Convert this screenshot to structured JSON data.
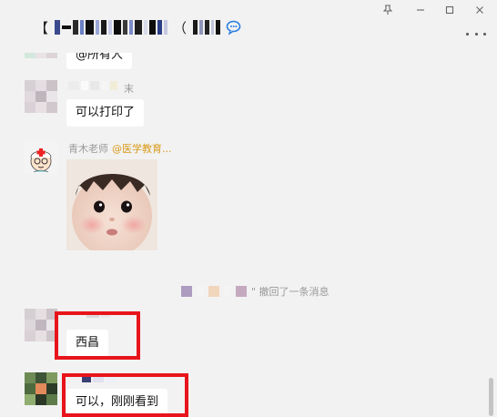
{
  "window": {
    "title": "【",
    "title_suffix": "（",
    "controls": {
      "pin": "📌",
      "minimize": "—",
      "maximize": "☐",
      "close": "✕"
    }
  },
  "messages": [
    {
      "id": "m0",
      "type": "text",
      "text": "@所有人"
    },
    {
      "id": "m1",
      "type": "text",
      "sender": "末",
      "text": "可以打印了"
    },
    {
      "id": "m2",
      "type": "image",
      "sender_name": "青木老师",
      "sender_tag": "@医学教育..."
    },
    {
      "id": "m3",
      "type": "system",
      "text": "\" 撤回了一条消息"
    },
    {
      "id": "m4",
      "type": "text",
      "text": "西昌"
    },
    {
      "id": "m5",
      "type": "text",
      "text": "可以，刚刚看到"
    }
  ],
  "colors": {
    "window_bg": "#f2f2f2",
    "bubble_bg": "#ffffff",
    "highlight": "#e8141b",
    "tag": "#d99a1a"
  }
}
